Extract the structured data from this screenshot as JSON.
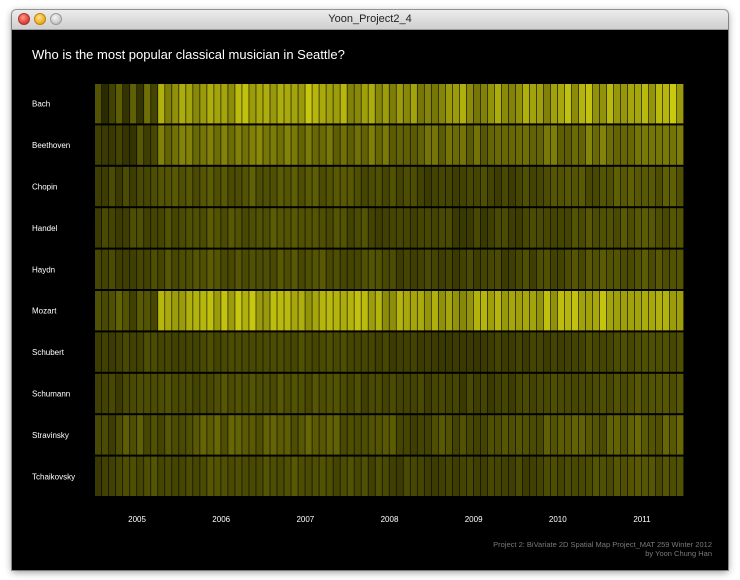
{
  "window": {
    "title": "Yoon_Project2_4"
  },
  "chart_title": "Who is the most popular classical musician in Seattle?",
  "credits": {
    "line1": "Project 2: BiVariate 2D Spatial Map Project_MAT 259 Winter 2012",
    "line2": "by Yoon Chung Han"
  },
  "colors": {
    "background": "#000000",
    "low": "#2a2a00",
    "high": "#ffff10",
    "grid": "#000000"
  },
  "chart_data": {
    "type": "heatmap",
    "title": "Who is the most popular classical musician in Seattle?",
    "rows": [
      "Bach",
      "Beethoven",
      "Chopin",
      "Handel",
      "Haydn",
      "Mozart",
      "Schubert",
      "Schumann",
      "Stravinsky",
      "Tchaikovsky"
    ],
    "x_labels": [
      "2005",
      "2006",
      "2007",
      "2008",
      "2009",
      "2010",
      "2011"
    ],
    "months_per_year": 12,
    "months": 84,
    "value_range": [
      0,
      1
    ],
    "row_levels": [
      {
        "base": 0.58,
        "early": 0.2,
        "amp": 0.15
      },
      {
        "base": 0.36,
        "early": 0.17,
        "amp": 0.09
      },
      {
        "base": 0.21,
        "early": 0.18,
        "amp": 0.05
      },
      {
        "base": 0.2,
        "early": 0.18,
        "amp": 0.05
      },
      {
        "base": 0.2,
        "early": 0.18,
        "amp": 0.05
      },
      {
        "base": 0.62,
        "early": 0.2,
        "amp": 0.12
      },
      {
        "base": 0.17,
        "early": 0.17,
        "amp": 0.03
      },
      {
        "base": 0.19,
        "early": 0.18,
        "amp": 0.04
      },
      {
        "base": 0.24,
        "early": 0.22,
        "amp": 0.07
      },
      {
        "base": 0.19,
        "early": 0.19,
        "amp": 0.04
      }
    ],
    "jump_month": 9,
    "legend": "none"
  }
}
